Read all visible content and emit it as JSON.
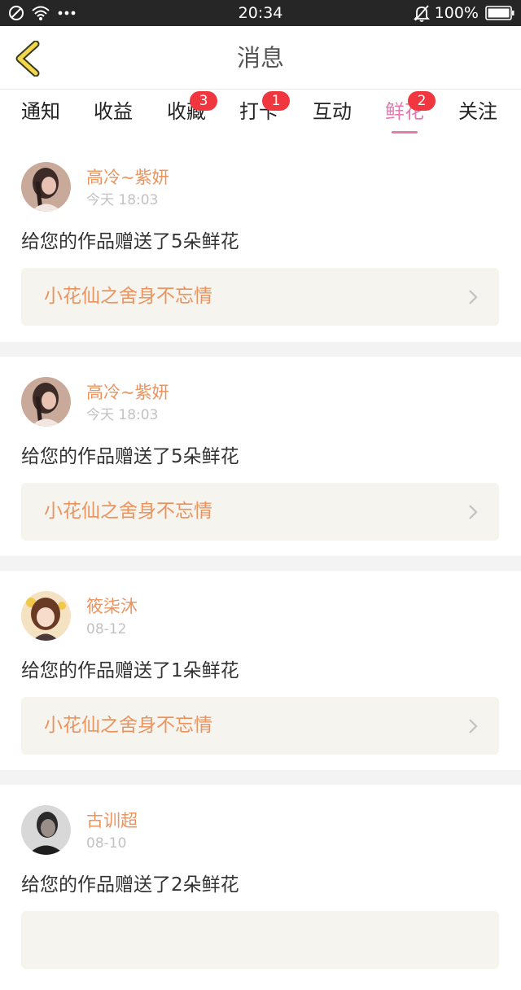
{
  "status_bar": {
    "time": "20:34",
    "battery": "100%"
  },
  "header": {
    "title": "消息"
  },
  "tabs": [
    {
      "label": "通知",
      "badge": ""
    },
    {
      "label": "收益",
      "badge": ""
    },
    {
      "label": "收藏",
      "badge": "3"
    },
    {
      "label": "打卡",
      "badge": "1"
    },
    {
      "label": "互动",
      "badge": ""
    },
    {
      "label": "鲜花",
      "badge": "2",
      "active": true
    },
    {
      "label": "关注",
      "badge": ""
    }
  ],
  "messages": [
    {
      "user": "高冷~紫妍",
      "time": "今天 18:03",
      "text": "给您的作品赠送了5朵鲜花",
      "work": "小花仙之舍身不忘情"
    },
    {
      "user": "高冷~紫妍",
      "time": "今天 18:03",
      "text": "给您的作品赠送了5朵鲜花",
      "work": "小花仙之舍身不忘情"
    },
    {
      "user": "筱柒沐",
      "time": "08-12",
      "text": "给您的作品赠送了1朵鲜花",
      "work": "小花仙之舍身不忘情"
    },
    {
      "user": "古训超",
      "time": "08-10",
      "text": "给您的作品赠送了2朵鲜花",
      "work": ""
    }
  ],
  "colors": {
    "accent": "#e879ad",
    "name": "#eb9460",
    "badge": "#f0363e",
    "link_bg": "#f5f4ee"
  }
}
